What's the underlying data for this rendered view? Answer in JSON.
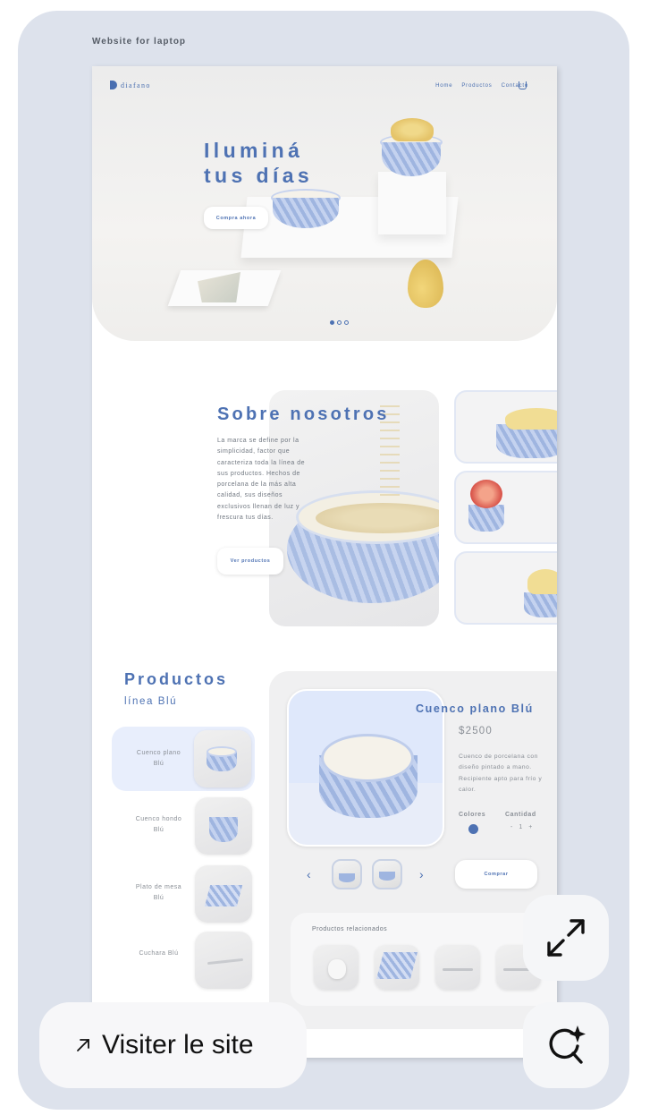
{
  "caption": "Website for laptop",
  "site": {
    "logo": "diafano",
    "nav": [
      "Home",
      "Productos",
      "Contacto"
    ],
    "hero": {
      "title_line1": "Iluminá",
      "title_line2": "tus días",
      "cta": "Compra ahora",
      "slide_count": 3,
      "active_slide": 1
    },
    "about": {
      "title": "Sobre nosotros",
      "text": "La marca se define por la simplicidad, factor que caracteriza toda la línea de sus productos. Hechos de porcelana de la más alta calidad, sus diseños exclusivos llenan de luz y frescura tus días.",
      "cta": "Ver productos"
    },
    "products": {
      "title": "Productos",
      "subtitle": "línea Blú",
      "items": [
        {
          "label": "Cuenco plano Blú",
          "active": true
        },
        {
          "label": "Cuenco hondo Blú",
          "active": false
        },
        {
          "label": "Plato de mesa Blú",
          "active": false
        },
        {
          "label": "Cuchara Blú",
          "active": false
        }
      ],
      "detail": {
        "name": "Cuenco plano Blú",
        "price": "$2500",
        "description": "Cuenco de porcelana con diseño pintado a mano. Recipiente apto para frío y calor.",
        "colors_label": "Colores",
        "quantity_label": "Cantidad",
        "quantity": "1",
        "minus": "-",
        "plus": "+",
        "prev": "‹",
        "next": "›",
        "buy": "Comprar",
        "selected_color": "#4e72b3"
      },
      "related_label": "Productos relacionados"
    }
  },
  "overlay": {
    "visit_label": "Visiter le site",
    "visit_icon": "arrow-up-right-icon",
    "expand_icon": "expand-icon",
    "visual_search_icon": "sparkle-search-icon"
  }
}
